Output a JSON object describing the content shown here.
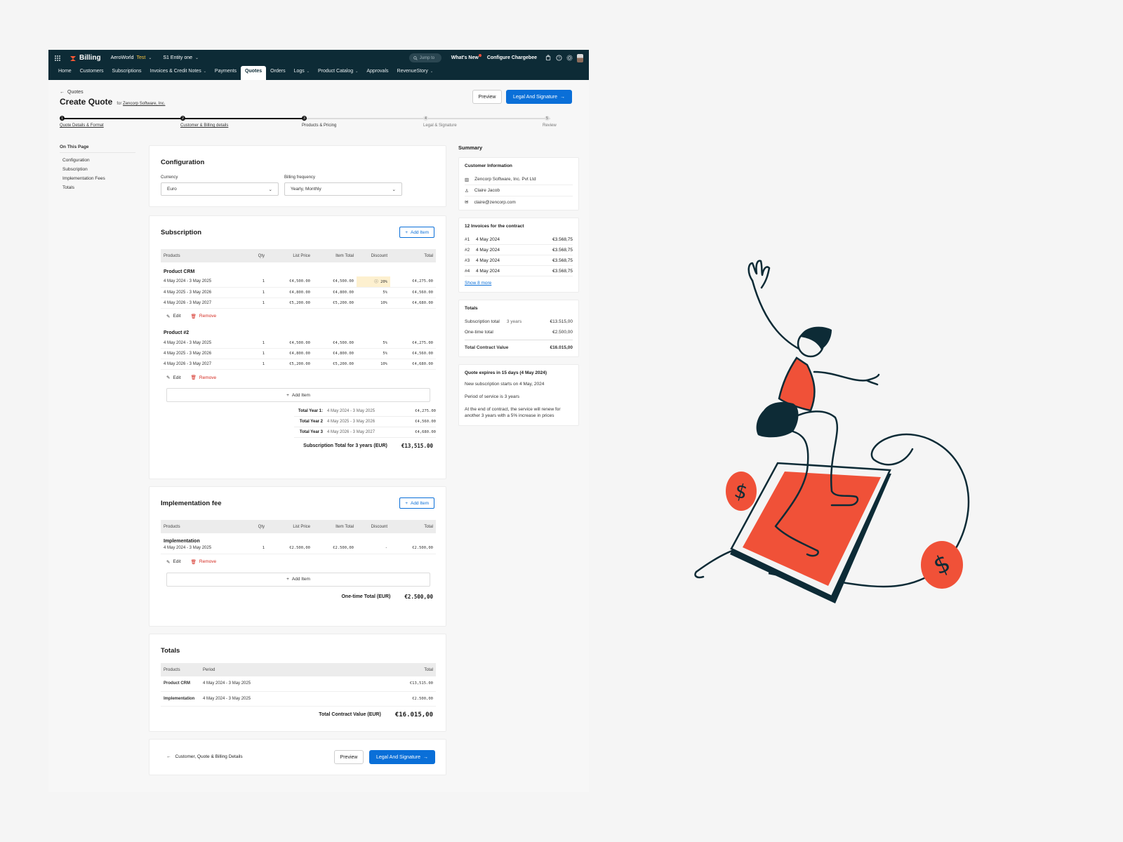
{
  "topbar": {
    "brand": "Billing",
    "org": "AeroWorld",
    "env": "Test",
    "entity": "S1 Entity one",
    "jump": "Jump to",
    "whats_new": "What's New",
    "configure": "Configure Chargebee"
  },
  "nav": [
    "Home",
    "Customers",
    "Subscriptions",
    "Invoices & Credit Notes",
    "Payments",
    "Quotes",
    "Orders",
    "Logs",
    "Product Catalog",
    "Approvals",
    "RevenueStory"
  ],
  "header": {
    "back": "Quotes",
    "title": "Create Quote",
    "for_label": "for",
    "customer_link": "Zencorp Software, Inc.",
    "preview": "Preview",
    "next": "Legal And Signature"
  },
  "steps": [
    {
      "num": "1",
      "label": "Quote Details & Format"
    },
    {
      "num": "2",
      "label": "Customer & Billing details"
    },
    {
      "num": "3",
      "label": "Products & Pricing"
    },
    {
      "num": "4",
      "label": "Legal & Signature"
    },
    {
      "num": "5",
      "label": "Review"
    }
  ],
  "onpage": {
    "title": "On This Page",
    "items": [
      "Configuration",
      "Subscription",
      "Implementation Fees",
      "Totals"
    ]
  },
  "config": {
    "title": "Configuration",
    "currency_label": "Currency",
    "currency_value": "Euro",
    "freq_label": "Billing frequency",
    "freq_value": "Yearly, Monthly"
  },
  "columns": [
    "Products",
    "Qty",
    "List Price",
    "Item Total",
    "Discount",
    "Total"
  ],
  "subscription": {
    "title": "Subscription",
    "add_item": "Add Item",
    "products": [
      {
        "name": "Product CRM",
        "rows": [
          {
            "period": "4 May 2024 - 3 May 2025",
            "qty": "1",
            "list": "€4,500.00",
            "item": "€4,500.00",
            "disc": "20%",
            "total": "€4,275.00"
          },
          {
            "period": "4 May 2025 - 3 May 2026",
            "qty": "1",
            "list": "€4,800.00",
            "item": "€4,800.00",
            "disc": "5%",
            "total": "€4,560.00"
          },
          {
            "period": "4 May 2026 - 3 May 2027",
            "qty": "1",
            "list": "€5,200.00",
            "item": "€5,200.00",
            "disc": "10%",
            "total": "€4,680.00"
          }
        ]
      },
      {
        "name": "Product #2",
        "rows": [
          {
            "period": "4 May 2024 - 3 May 2025",
            "qty": "1",
            "list": "€4,500.00",
            "item": "€4,500.00",
            "disc": "5%",
            "total": "€4,275.00"
          },
          {
            "period": "4 May 2025 - 3 May 2026",
            "qty": "1",
            "list": "€4,800.00",
            "item": "€4,800.00",
            "disc": "5%",
            "total": "€4,560.00"
          },
          {
            "period": "4 May 2026 - 3 May 2027",
            "qty": "1",
            "list": "€5,200.00",
            "item": "€5,200.00",
            "disc": "10%",
            "total": "€4,680.00"
          }
        ]
      }
    ],
    "edit": "Edit",
    "remove": "Remove",
    "years": [
      {
        "k": "Total Year 1:",
        "p": "4 May 2024 - 3 May 2025",
        "v": "€4,275.00"
      },
      {
        "k": "Total Year 2",
        "p": "4 May 2025 - 3 May 2026",
        "v": "€4,560.00"
      },
      {
        "k": "Total Year 3",
        "p": "4 May 2026 - 3 May 2027",
        "v": "€4,680.00"
      }
    ],
    "total_label": "Subscription Total for 3 years (EUR)",
    "total_value": "€13,515.00"
  },
  "implementation": {
    "title": "Implementation fee",
    "add_item": "Add Item",
    "name": "Implementation",
    "row": {
      "period": "4 May 2024 - 3 May 2025",
      "qty": "1",
      "list": "€2.500,00",
      "item": "€2.500,00",
      "disc": "-",
      "total": "€2.500,00"
    },
    "total_label": "One-time Total (EUR)",
    "total_value": "€2.500,00"
  },
  "totals": {
    "title": "Totals",
    "columns": [
      "Products",
      "Period",
      "Total"
    ],
    "rows": [
      {
        "name": "Product CRM",
        "period": "4 May 2024 - 3 May 2025",
        "total": "€13,515.00"
      },
      {
        "name": "Implementation",
        "period": "4 May 2024 - 3 May 2025",
        "total": "€2.500,00"
      }
    ],
    "grand_label": "Total Contract Value (EUR)",
    "grand_value": "€16.015,00"
  },
  "footer": {
    "back": "Customer, Quote & Billing Details",
    "preview": "Preview",
    "next": "Legal And Signature"
  },
  "summary": {
    "title": "Summary",
    "customer": {
      "title": "Customer Information",
      "company": "Zencorp Software, Inc. Pvt Ltd",
      "contact": "Claire Jacob",
      "email": "claire@zencorp.com"
    },
    "invoices": {
      "title": "12 Invoices for the contract",
      "rows": [
        {
          "n": "#1",
          "d": "4 May 2024",
          "a": "€3.568,75"
        },
        {
          "n": "#2",
          "d": "4 May 2024",
          "a": "€3.568,75"
        },
        {
          "n": "#3",
          "d": "4 May 2024",
          "a": "€3.568,75"
        },
        {
          "n": "#4",
          "d": "4 May 2024",
          "a": "€3.568,75"
        }
      ],
      "more": "Show 8 more"
    },
    "totals": {
      "title": "Totals",
      "sub_label": "Subscription total",
      "sub_meta": "3 years",
      "sub_value": "€13.515,00",
      "one_label": "One-time total",
      "one_value": "€2.500,00",
      "tcv_label": "Total Contract Value",
      "tcv_value": "€16.015,00"
    },
    "expiry": {
      "title": "Quote expires in 15 days (4 May 2024)",
      "l1": "New subscription starts on 4 May, 2024",
      "l2": "Period of service is 3 years",
      "l3": "At the end of contract, the service will renew for another 3 years with a 5% increase in prices"
    }
  },
  "colors": {
    "navy": "#0d2b36",
    "primary": "#0a6fd8",
    "accent": "#f05138",
    "remove": "#d42a20"
  }
}
